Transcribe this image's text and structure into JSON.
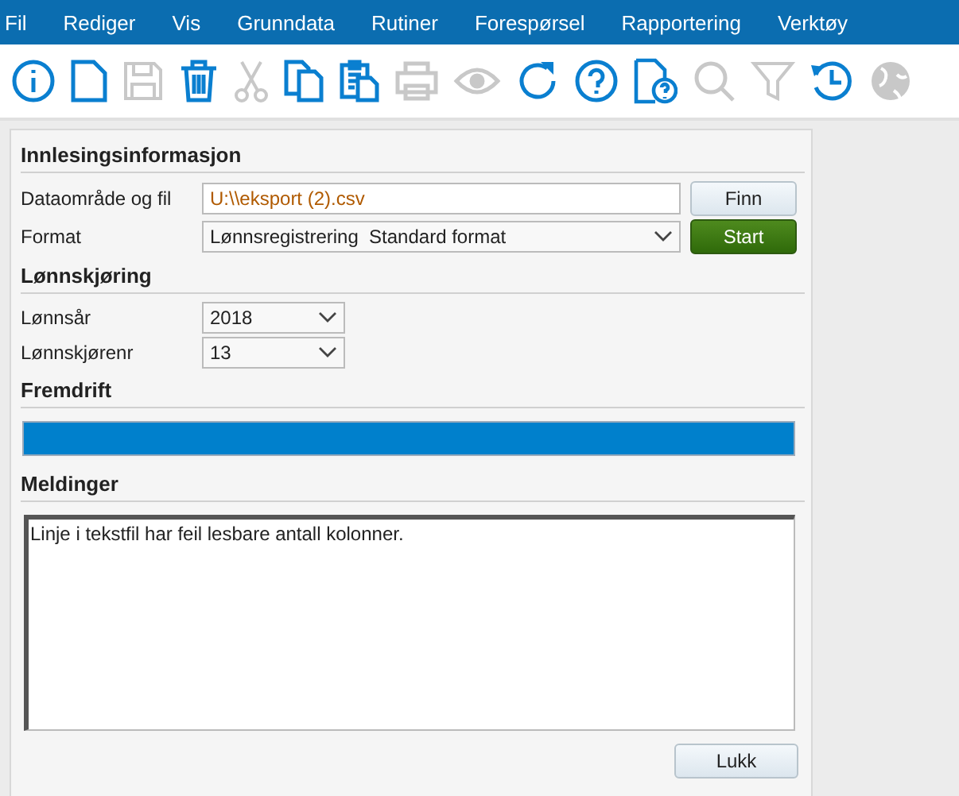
{
  "menu": [
    "Fil",
    "Rediger",
    "Vis",
    "Grunndata",
    "Rutiner",
    "Forespørsel",
    "Rapportering",
    "Verktøy"
  ],
  "toolbar": [
    {
      "kind": "info",
      "disabled": false
    },
    {
      "kind": "new",
      "disabled": false
    },
    {
      "kind": "save",
      "disabled": true
    },
    {
      "kind": "trash",
      "disabled": false
    },
    {
      "kind": "cut",
      "disabled": true
    },
    {
      "kind": "copy",
      "disabled": false
    },
    {
      "kind": "paste",
      "disabled": false
    },
    {
      "kind": "print",
      "disabled": true
    },
    {
      "kind": "eye",
      "disabled": true
    },
    {
      "kind": "refresh",
      "disabled": false
    },
    {
      "kind": "help",
      "disabled": false
    },
    {
      "kind": "dochelp",
      "disabled": false
    },
    {
      "kind": "search",
      "disabled": true
    },
    {
      "kind": "filter",
      "disabled": true
    },
    {
      "kind": "history",
      "disabled": false
    },
    {
      "kind": "globe",
      "disabled": true
    }
  ],
  "import_section": {
    "title": "Innlesingsinformasjon",
    "file_label": "Dataområde og fil",
    "file_value": "U:\\\\eksport (2).csv",
    "find_button": "Finn",
    "format_label": "Format",
    "format_value": "Lønnsregistrering  Standard format",
    "start_button": "Start"
  },
  "payroll_section": {
    "title": "Lønnskjøring",
    "year_label": "Lønnsår",
    "year_value": "2018",
    "run_label": "Lønnskjørenr",
    "run_value": "13"
  },
  "progress_section": {
    "title": "Fremdrift",
    "level": 1
  },
  "messages_section": {
    "title": "Meldinger",
    "text": "Linje i tekstfil har feil lesbare antall kolonner."
  },
  "close_button": "Lukk"
}
